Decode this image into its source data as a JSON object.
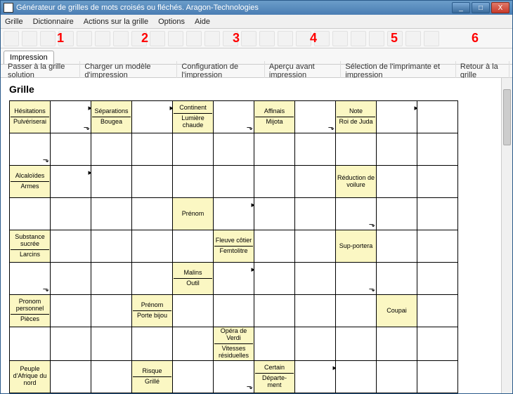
{
  "window": {
    "title": "Générateur de grilles de mots croisés ou fléchés. Aragon-Technologies",
    "min": "_",
    "max": "□",
    "close": "X"
  },
  "menu": {
    "grille": "Grille",
    "dict": "Dictionnaire",
    "actions": "Actions sur la grille",
    "options": "Options",
    "aide": "Aide"
  },
  "marks": {
    "m1": "1",
    "m2": "2",
    "m3": "3",
    "m4": "4",
    "m5": "5",
    "m6": "6"
  },
  "tab": {
    "active": "Impression"
  },
  "sub": {
    "b1": "Passer à la grille solution",
    "b2": "Charger un modèle d'impression",
    "b3": "Configuration de l'impression",
    "b4": "Aperçu avant impression",
    "b5": "Sélection de l'imprimante et impression",
    "b6": "Retour à la grille"
  },
  "heading": "Grille",
  "clues": {
    "r0c0a": "Hésitations",
    "r0c0b": "Pulvériserai",
    "r0c2a": "Séparations",
    "r0c2b": "Bougea",
    "r0c4a": "Continent",
    "r0c4b": "Lumière chaude",
    "r0c6a": "Affinais",
    "r0c6b": "Mijota",
    "r0c8a": "Note",
    "r0c8b": "Roi de Juda",
    "r2c0a": "Alcaloïdes",
    "r2c0b": "Armes",
    "r2c8": "Réduction de voilure",
    "r3c4": "Prénom",
    "r4c0a": "Substance sucrée",
    "r4c0b": "Larcins",
    "r4c5a": "Fleuve côtier",
    "r4c5b": "Femtolitre",
    "r4c8": "Sup-portera",
    "r5c4a": "Malins",
    "r5c4b": "Outil",
    "r6c0a": "Pronom personnel",
    "r6c0b": "Pièces",
    "r6c3a": "Prénom",
    "r6c3b": "Porte bijou",
    "r6c9": "Coupai",
    "r7c5a": "Opéra de Verdi",
    "r7c5b": "Vitesses résiduelles",
    "r8c0": "Peuple d'Afrique du nord",
    "r8c3a": "Risque",
    "r8c3b": "Grillé",
    "r8c6a": "Certain",
    "r8c6b": "Départe-ment"
  }
}
